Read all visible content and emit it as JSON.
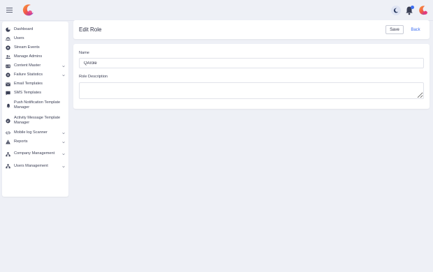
{
  "header": {
    "title": "Edit Role",
    "save_label": "Save",
    "back_label": "Back"
  },
  "form": {
    "name_label": "Name",
    "name_value": "QArole",
    "description_label": "Role Description",
    "description_value": ""
  },
  "sidebar": {
    "items": [
      {
        "label": "Dashboard",
        "icon": "dashboard-icon",
        "has_chevron": false
      },
      {
        "label": "Users",
        "icon": "users-icon",
        "has_chevron": false
      },
      {
        "label": "Stream Events",
        "icon": "stream-icon",
        "has_chevron": false
      },
      {
        "label": "Manage Admins",
        "icon": "admins-icon",
        "has_chevron": false
      },
      {
        "label": "Content Master",
        "icon": "content-icon",
        "has_chevron": true
      },
      {
        "label": "Failure Statistics",
        "icon": "gear-icon",
        "has_chevron": true
      },
      {
        "label": "Email Templates",
        "icon": "email-icon",
        "has_chevron": false
      },
      {
        "label": "SMS Templates",
        "icon": "sms-icon",
        "has_chevron": false
      },
      {
        "label": "Push Notification Template Manager",
        "icon": "bell-icon",
        "has_chevron": false
      },
      {
        "label": "Activity Message Template Manager",
        "icon": "message-icon",
        "has_chevron": false
      },
      {
        "label": "Mobile log Scanner",
        "icon": "code-icon",
        "has_chevron": true
      },
      {
        "label": "Reports",
        "icon": "warning-icon",
        "has_chevron": true
      },
      {
        "label": "Company Management",
        "icon": "company-icon",
        "has_chevron": true
      },
      {
        "label": "Users Management",
        "icon": "users-management-icon",
        "has_chevron": true
      }
    ]
  },
  "topbar": {
    "icons": [
      "menu-icon",
      "app-logo",
      "moon-icon",
      "bell-icon",
      "avatar"
    ]
  },
  "colors": {
    "accent": "#3c6df0",
    "background": "#eef0f6",
    "card": "#ffffff",
    "logo_gradient": [
      "#f26a3d",
      "#e63a7a",
      "#7b3fe4"
    ]
  }
}
